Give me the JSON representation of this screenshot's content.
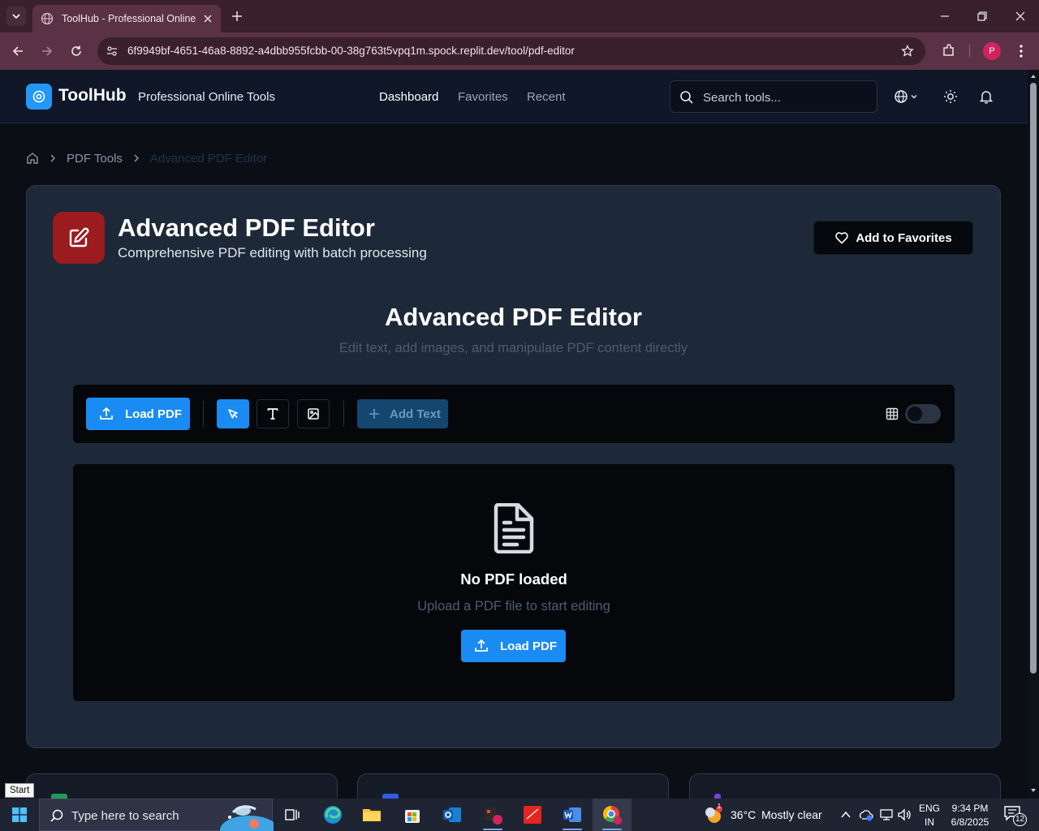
{
  "browser": {
    "tab_title": "ToolHub - Professional Online T",
    "url": "6f9949bf-4651-46a8-8892-a4dbb955fcbb-00-38g763t5vpq1m.spock.replit.dev/tool/pdf-editor",
    "profile_initial": "P"
  },
  "header": {
    "logo_text": "ToolHub",
    "logo_subtitle": "Professional Online Tools",
    "nav": [
      "Dashboard",
      "Favorites",
      "Recent"
    ],
    "active_nav": "Dashboard",
    "search_placeholder": "Search tools..."
  },
  "breadcrumb": {
    "items": [
      "PDF Tools",
      "Advanced PDF Editor"
    ]
  },
  "tool": {
    "title": "Advanced PDF Editor",
    "description": "Comprehensive PDF editing with batch processing",
    "favorite_label": "Add to Favorites"
  },
  "editor": {
    "title": "Advanced PDF Editor",
    "subtitle": "Edit text, add images, and manipulate PDF content directly",
    "load_label": "Load PDF",
    "add_text_label": "Add Text",
    "grid_toggle_on": false,
    "empty": {
      "title": "No PDF loaded",
      "subtitle": "Upload a PDF file to start editing",
      "load_label": "Load PDF"
    }
  },
  "tooltip": "Start",
  "taskbar": {
    "search_placeholder": "Type here to search",
    "weather_temp": "36°C",
    "weather_desc": "Mostly clear",
    "weather_badge": "1",
    "lang_line1": "ENG",
    "lang_line2": "IN",
    "time": "9:34 PM",
    "date": "6/8/2025",
    "notifications": "12"
  },
  "colors": {
    "accent": "#1a8bf2",
    "tool_icon_bg": "#9b1b1f",
    "card_bg": "#1d2838",
    "browser_frame": "#5b3245"
  }
}
